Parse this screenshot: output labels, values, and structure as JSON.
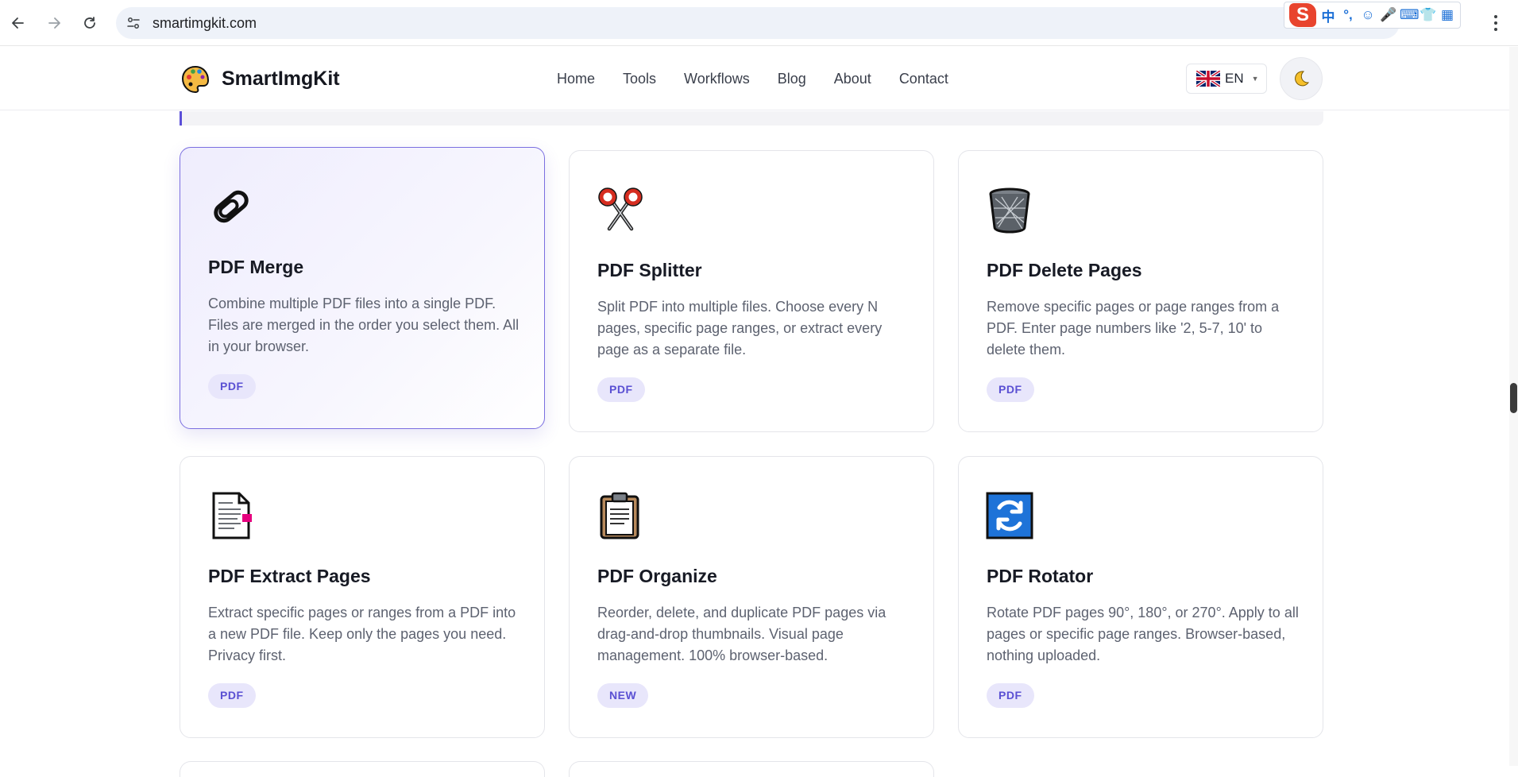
{
  "browser": {
    "url": "smartimgkit.com",
    "ime_items": [
      "中",
      "°,",
      "☺",
      "🎤",
      "⌨",
      "👕",
      "▦"
    ]
  },
  "header": {
    "logo_text": "SmartImgKit",
    "nav": [
      "Home",
      "Tools",
      "Workflows",
      "Blog",
      "About",
      "Contact"
    ],
    "language": "EN"
  },
  "cards": [
    {
      "title": "PDF Merge",
      "desc": "Combine multiple PDF files into a single PDF. Files are merged in the order you select them. All in your browser.",
      "tag": "PDF",
      "icon": "paperclip-icon"
    },
    {
      "title": "PDF Splitter",
      "desc": "Split PDF into multiple files. Choose every N pages, specific page ranges, or extract every page as a separate file.",
      "tag": "PDF",
      "icon": "scissors-icon"
    },
    {
      "title": "PDF Delete Pages",
      "desc": "Remove specific pages or page ranges from a PDF. Enter page numbers like '2, 5-7, 10' to delete them.",
      "tag": "PDF",
      "icon": "trash-bin-icon"
    },
    {
      "title": "PDF Extract Pages",
      "desc": "Extract specific pages or ranges from a PDF into a new PDF file. Keep only the pages you need. Privacy first.",
      "tag": "PDF",
      "icon": "document-icon"
    },
    {
      "title": "PDF Organize",
      "desc": "Reorder, delete, and duplicate PDF pages via drag-and-drop thumbnails. Visual page management. 100% browser-based.",
      "tag": "NEW",
      "icon": "clipboard-icon"
    },
    {
      "title": "PDF Rotator",
      "desc": "Rotate PDF pages 90°, 180°, or 270°. Apply to all pages or specific page ranges. Browser-based, nothing uploaded.",
      "tag": "PDF",
      "icon": "rotate-icon"
    }
  ],
  "colors": {
    "accent": "#5b4fd8",
    "tag_bg": "#e8e6fb",
    "active_border": "#7b6fe0"
  }
}
